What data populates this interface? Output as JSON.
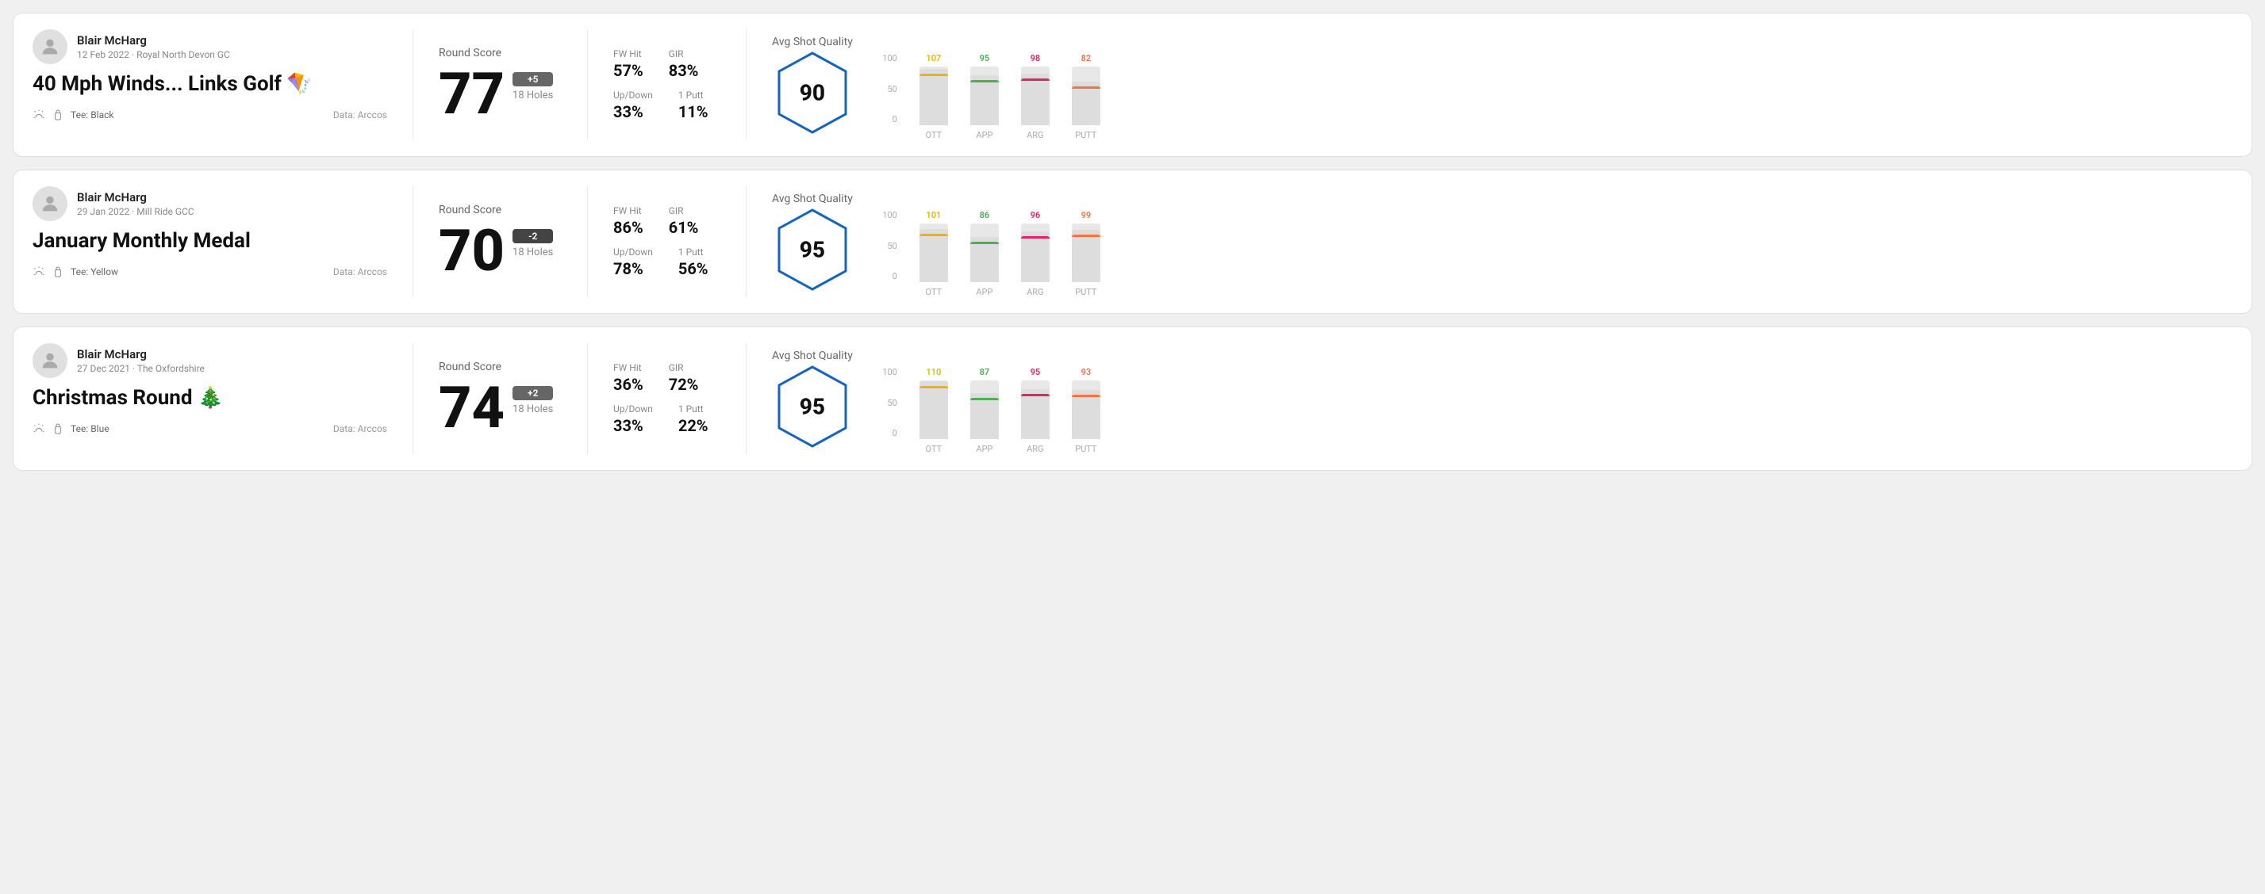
{
  "rounds": [
    {
      "id": "round1",
      "user": "Blair McHarg",
      "date_course": "12 Feb 2022 · Royal North Devon GC",
      "title": "40 Mph Winds... Links Golf 🪁",
      "tee": "Black",
      "data_source": "Data: Arccos",
      "score": "77",
      "score_diff": "+5",
      "holes": "18 Holes",
      "fw_hit": "57%",
      "gir": "83%",
      "up_down": "33%",
      "one_putt": "11%",
      "avg_quality": "90",
      "quality_label": "Avg Shot Quality",
      "chart": {
        "ott": {
          "value": 107,
          "color": "#e6b800",
          "percent": 80
        },
        "app": {
          "value": 95,
          "color": "#4caf50",
          "percent": 65
        },
        "arg": {
          "value": 98,
          "color": "#e91e63",
          "percent": 68
        },
        "putt": {
          "value": 82,
          "color": "#ff7043",
          "percent": 55
        }
      }
    },
    {
      "id": "round2",
      "user": "Blair McHarg",
      "date_course": "29 Jan 2022 · Mill Ride GCC",
      "title": "January Monthly Medal",
      "tee": "Yellow",
      "data_source": "Data: Arccos",
      "score": "70",
      "score_diff": "-2",
      "holes": "18 Holes",
      "fw_hit": "86%",
      "gir": "61%",
      "up_down": "78%",
      "one_putt": "56%",
      "avg_quality": "95",
      "quality_label": "Avg Shot Quality",
      "chart": {
        "ott": {
          "value": 101,
          "color": "#e6b800",
          "percent": 78
        },
        "app": {
          "value": 86,
          "color": "#4caf50",
          "percent": 60
        },
        "arg": {
          "value": 96,
          "color": "#e91e63",
          "percent": 72
        },
        "putt": {
          "value": 99,
          "color": "#ff7043",
          "percent": 76
        }
      }
    },
    {
      "id": "round3",
      "user": "Blair McHarg",
      "date_course": "27 Dec 2021 · The Oxfordshire",
      "title": "Christmas Round 🎄",
      "tee": "Blue",
      "data_source": "Data: Arccos",
      "score": "74",
      "score_diff": "+2",
      "holes": "18 Holes",
      "fw_hit": "36%",
      "gir": "72%",
      "up_down": "33%",
      "one_putt": "22%",
      "avg_quality": "95",
      "quality_label": "Avg Shot Quality",
      "chart": {
        "ott": {
          "value": 110,
          "color": "#e6b800",
          "percent": 84
        },
        "app": {
          "value": 87,
          "color": "#4caf50",
          "percent": 61
        },
        "arg": {
          "value": 95,
          "color": "#e91e63",
          "percent": 70
        },
        "putt": {
          "value": 93,
          "color": "#ff7043",
          "percent": 68
        }
      }
    }
  ],
  "y_axis": [
    "100",
    "50",
    "0"
  ],
  "chart_labels": [
    "OTT",
    "APP",
    "ARG",
    "PUTT"
  ]
}
